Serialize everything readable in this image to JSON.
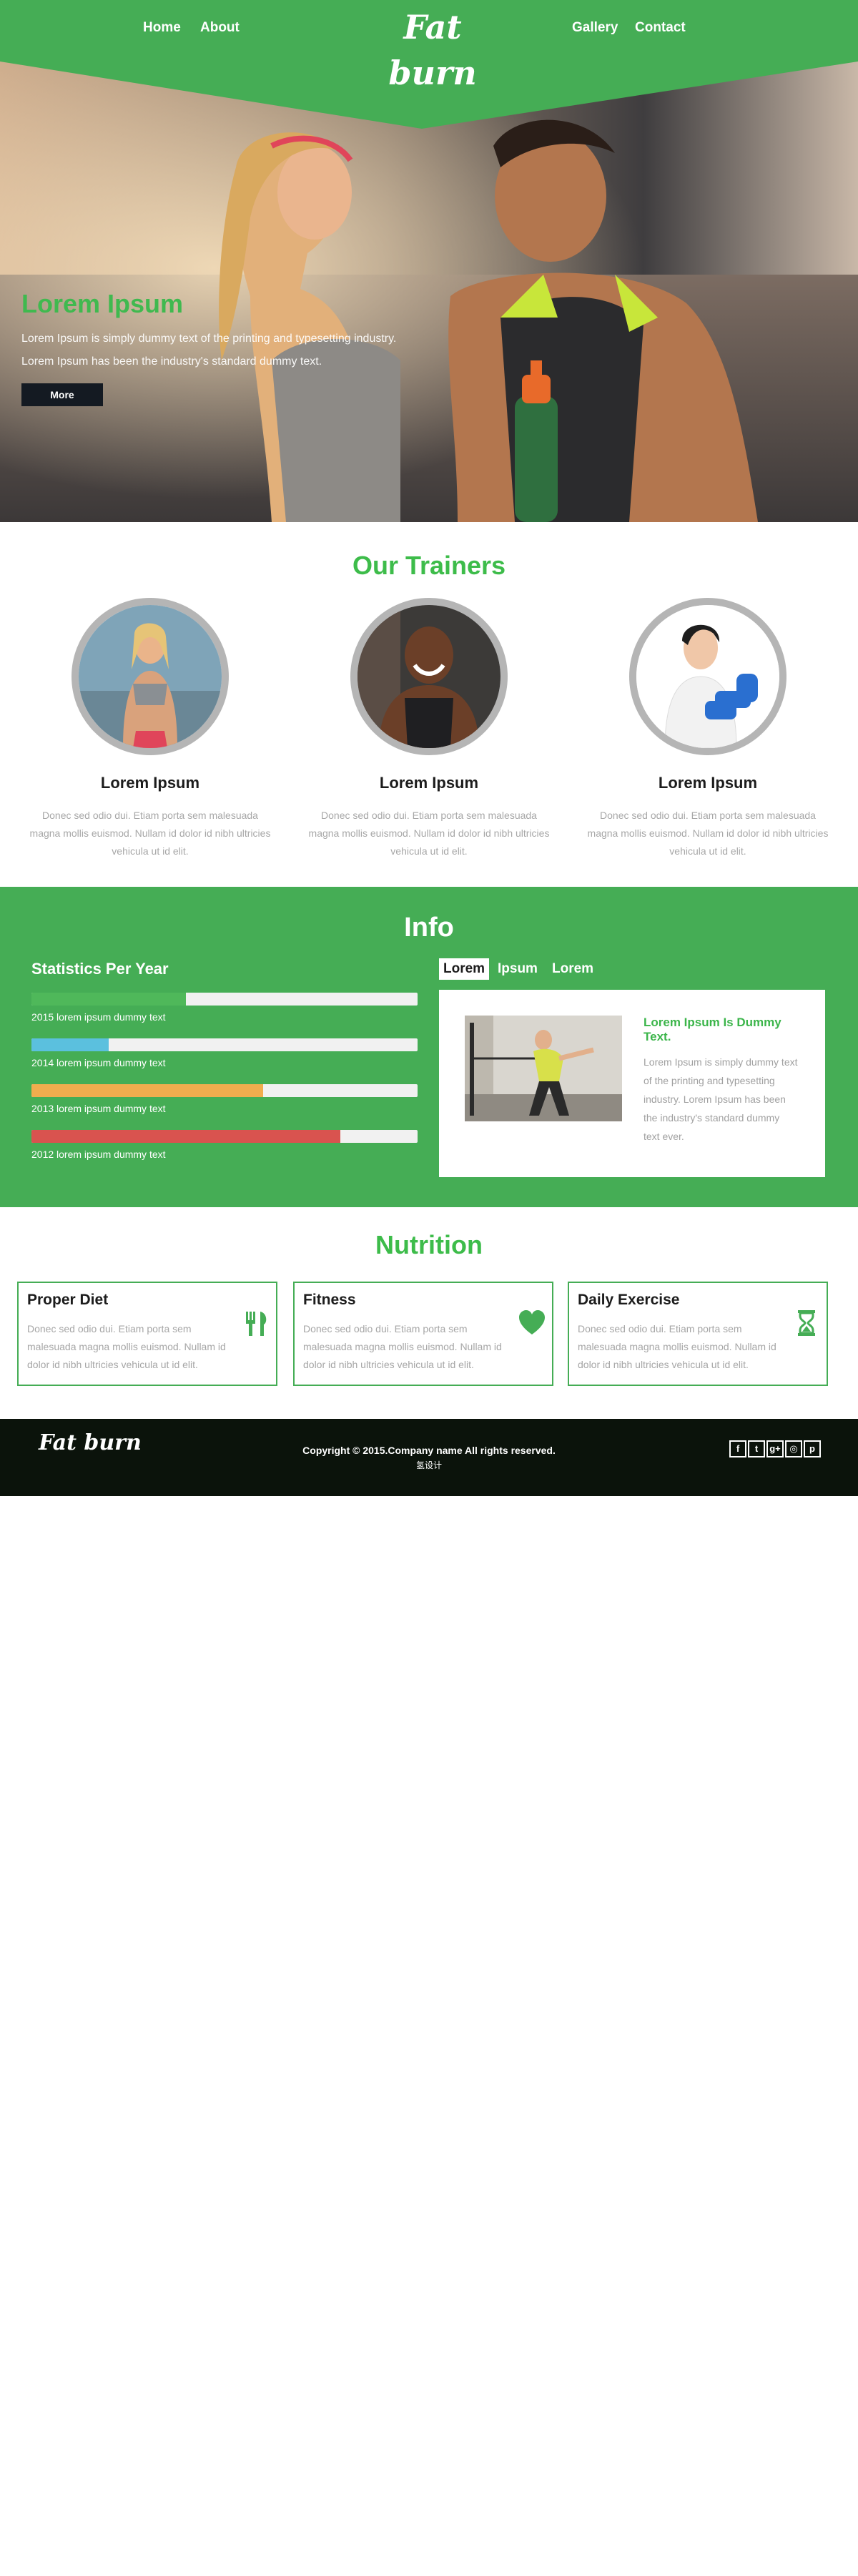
{
  "header": {
    "nav_left": [
      "Home",
      "About"
    ],
    "nav_right": [
      "Gallery",
      "Contact"
    ],
    "logo": "Fat burn",
    "color": "#45ad55"
  },
  "hero": {
    "title": "Lorem Ipsum",
    "text": "Lorem Ipsum is simply dummy text of the printing and typesetting industry. Lorem Ipsum has been the industry's standard dummy text.",
    "button": "More",
    "image_icon": "couple-fitness-photo"
  },
  "trainers": {
    "title": "Our Trainers",
    "items": [
      {
        "name": "Lorem Ipsum",
        "desc": "Donec sed odio dui. Etiam porta sem malesuada magna mollis euismod. Nullam id dolor id nibh ultricies vehicula ut id elit.",
        "image_icon": "female-trainer-photo"
      },
      {
        "name": "Lorem Ipsum",
        "desc": "Donec sed odio dui. Etiam porta sem malesuada magna mollis euismod. Nullam id dolor id nibh ultricies vehicula ut id elit.",
        "image_icon": "male-trainer-photo"
      },
      {
        "name": "Lorem Ipsum",
        "desc": "Donec sed odio dui. Etiam porta sem malesuada magna mollis euismod. Nullam id dolor id nibh ultricies vehicula ut id elit.",
        "image_icon": "dumbbell-trainer-photo"
      }
    ]
  },
  "info": {
    "title": "Info",
    "stats_title": "Statistics Per Year",
    "stats": [
      {
        "label": "2015 lorem ipsum dummy text",
        "value": 0.4,
        "color": "#4fb85a"
      },
      {
        "label": "2014 lorem ipsum dummy text",
        "value": 0.2,
        "color": "#5bc0de"
      },
      {
        "label": "2013 lorem ipsum dummy text",
        "value": 0.6,
        "color": "#f0ad4e"
      },
      {
        "label": "2012 lorem ipsum dummy text",
        "value": 0.8,
        "color": "#d9534f"
      }
    ],
    "tabs": [
      "Lorem",
      "Ipsum",
      "Lorem"
    ],
    "panel": {
      "title": "Lorem Ipsum Is Dummy Text.",
      "text": "Lorem Ipsum is simply dummy text of the printing and typesetting industry. Lorem Ipsum has been the industry's standard dummy text ever.",
      "image_icon": "workout-photo"
    }
  },
  "nutrition": {
    "title": "Nutrition",
    "cards": [
      {
        "title": "Proper Diet",
        "text": "Donec sed odio dui. Etiam porta sem malesuada magna mollis euismod. Nullam id dolor id nibh ultricies vehicula ut id elit.",
        "icon": "cutlery-icon"
      },
      {
        "title": "Fitness",
        "text": "Donec sed odio dui. Etiam porta sem malesuada magna mollis euismod. Nullam id dolor id nibh ultricies vehicula ut id elit.",
        "icon": "heart-icon"
      },
      {
        "title": "Daily Exercise",
        "text": "Donec sed odio dui. Etiam porta sem malesuada magna mollis euismod. Nullam id dolor id nibh ultricies vehicula ut id elit.",
        "icon": "hourglass-icon"
      }
    ]
  },
  "footer": {
    "logo": "Fat burn",
    "copyright": "Copyright © 2015.Company name All rights reserved.",
    "sub": "氢设计",
    "social": [
      {
        "name": "facebook-icon",
        "glyph": "f"
      },
      {
        "name": "twitter-icon",
        "glyph": "t"
      },
      {
        "name": "google-plus-icon",
        "glyph": "g+"
      },
      {
        "name": "instagram-icon",
        "glyph": "◎"
      },
      {
        "name": "pinterest-icon",
        "glyph": "p"
      }
    ]
  }
}
